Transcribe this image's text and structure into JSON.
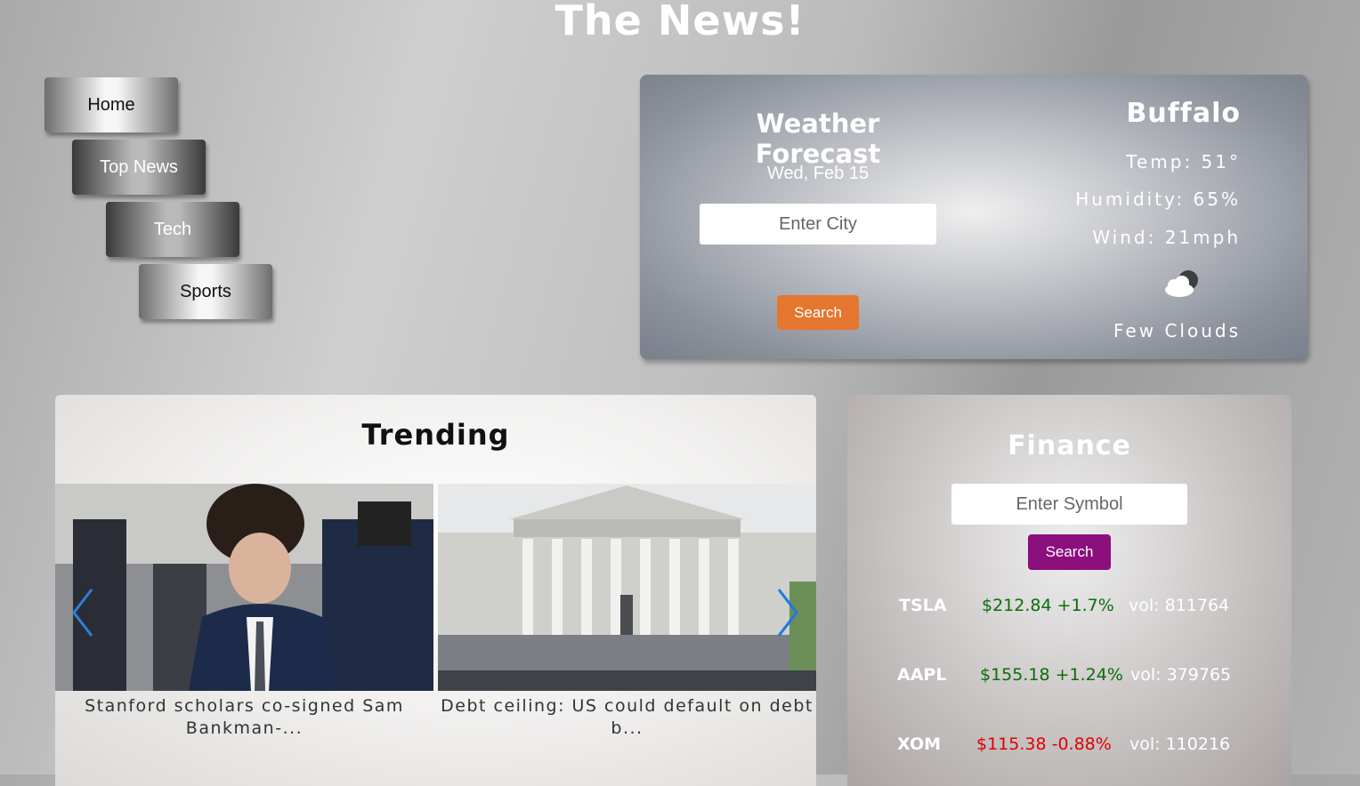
{
  "site": {
    "title": "The News!"
  },
  "nav": {
    "items": [
      {
        "label": "Home"
      },
      {
        "label": "Top News"
      },
      {
        "label": "Tech"
      },
      {
        "label": "Sports"
      }
    ]
  },
  "weather": {
    "title": "Weather Forecast",
    "date": "Wed, Feb 15",
    "input_placeholder": "Enter City",
    "search_label": "Search",
    "city": "Buffalo",
    "temp": "Temp: 51°",
    "humidity": "Humidity: 65%",
    "wind": "Wind: 21mph",
    "condition_icon": "cloud-icon",
    "condition": "Few Clouds",
    "search_color": "#e5762f"
  },
  "trending": {
    "title": "Trending",
    "articles": [
      {
        "caption": "Stanford scholars co-signed Sam Bankman-..."
      },
      {
        "caption": "Debt ceiling: US could default on debt b..."
      }
    ],
    "prev_icon": "chevron-left-icon",
    "next_icon": "chevron-right-icon"
  },
  "finance": {
    "title": "Finance",
    "input_placeholder": "Enter Symbol",
    "search_label": "Search",
    "search_color": "#8b0f7d",
    "stocks": [
      {
        "symbol": "TSLA",
        "change": "$212.84 +1.7%",
        "direction": "up",
        "volume": "vol: 811764"
      },
      {
        "symbol": "AAPL",
        "change": "$155.18 +1.24%",
        "direction": "up",
        "volume": "vol: 379765"
      },
      {
        "symbol": "XOM",
        "change": "$115.38 -0.88%",
        "direction": "down",
        "volume": "vol: 110216"
      }
    ]
  }
}
